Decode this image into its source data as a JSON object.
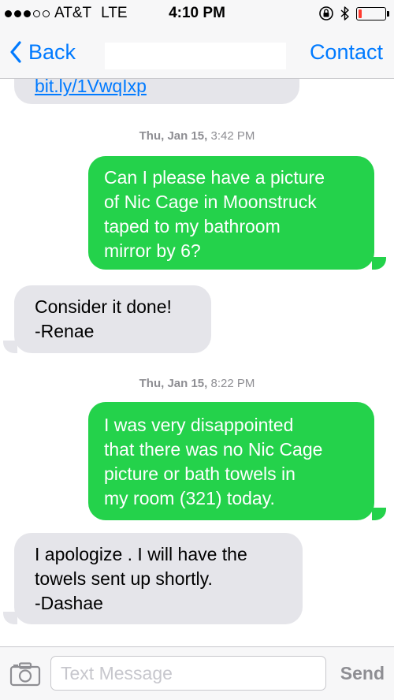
{
  "status_bar": {
    "carrier": "AT&T",
    "network": "LTE",
    "time": "4:10 PM",
    "battery_level": 0.12,
    "battery_color": "#ff3b30"
  },
  "nav": {
    "back_label": "Back",
    "contact_label": "Contact"
  },
  "messages": {
    "m0_link": "bit.ly/1VwqIxp",
    "ts1_day": "Thu, Jan 15,",
    "ts1_time": "3:42 PM",
    "m1_line1": "Can I please have a picture",
    "m1_line2": "of Nic Cage in Moonstruck",
    "m1_line3": "taped to my bathroom",
    "m1_line4": "mirror by 6?",
    "m2_line1": "Consider it done!",
    "m2_line2": "-Renae",
    "ts2_day": "Thu, Jan 15,",
    "ts2_time": "8:22 PM",
    "m3_line1": "I was very disappointed",
    "m3_line2": "that there was no Nic Cage",
    "m3_line3": "picture or bath towels in",
    "m3_line4": "my room (321) today.",
    "m4_line1": "I apologize . I will have the",
    "m4_line2": "towels sent up shortly.",
    "m4_line3": "-Dashae"
  },
  "input": {
    "placeholder": "Text Message",
    "send_label": "Send"
  },
  "colors": {
    "accent": "#007aff",
    "outgoing_bubble": "#24d24b",
    "incoming_bubble": "#e5e5ea"
  }
}
